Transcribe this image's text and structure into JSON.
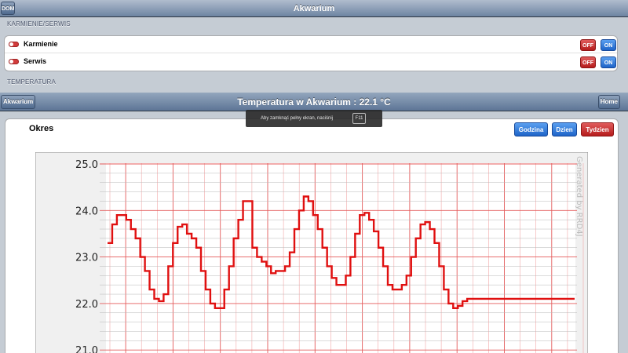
{
  "top_bar": {
    "back_label": "DOM",
    "title": "Akwarium"
  },
  "feeding": {
    "section_title": "KARMIENIE/SERWIS",
    "rows": [
      {
        "label": "Karmienie",
        "off": "OFF",
        "on": "ON"
      },
      {
        "label": "Serwis",
        "off": "OFF",
        "on": "ON"
      }
    ]
  },
  "temperature_section": {
    "title": "TEMPERATURA"
  },
  "chart_bar": {
    "left_label": "Akwarium",
    "title": "Temperatura w Akwarium : 22.1 °C",
    "right_label": "Home"
  },
  "toast": {
    "text": "Aby zamknąć pełny ekran, naciśnij",
    "key": "F11"
  },
  "content": {
    "okres_label": "Okres",
    "buttons": {
      "godzina": "Godzina",
      "dzien": "Dzien",
      "tydzien": "Tydzien"
    }
  },
  "colors": {
    "line": "#e01010",
    "grid": "#f2a8a8",
    "accent_blue": "#1e64c8",
    "accent_red": "#b51c1c"
  },
  "chart_data": {
    "type": "line",
    "watermark": "Generated by RRD4J",
    "ylim": [
      21.0,
      25.0
    ],
    "yticks": [
      "25.0",
      "24.0",
      "23.0",
      "22.0",
      "21.0"
    ],
    "grid": true,
    "x_index": [
      0,
      1,
      2,
      3,
      4,
      5,
      6,
      7,
      8,
      9,
      10,
      11,
      12,
      13,
      14,
      15,
      16,
      17,
      18,
      19,
      20,
      21,
      22,
      23,
      24,
      25,
      26,
      27,
      28,
      29,
      30,
      31,
      32,
      33,
      34,
      35,
      36,
      37,
      38,
      39,
      40,
      41,
      42,
      43,
      44,
      45,
      46,
      47,
      48,
      49,
      50,
      51,
      52,
      53,
      54,
      55,
      56,
      57,
      58,
      59,
      60,
      61,
      62,
      63,
      64,
      65,
      66,
      67,
      68,
      69,
      70,
      71,
      72,
      73,
      74,
      75,
      76,
      77,
      78,
      79,
      80,
      81,
      82,
      83,
      84,
      85,
      86,
      87,
      88,
      89,
      90,
      91,
      92,
      93,
      94,
      95,
      96,
      97,
      98,
      99,
      100
    ],
    "series": [
      {
        "values": [
          23.3,
          23.7,
          23.9,
          23.9,
          23.8,
          23.6,
          23.4,
          23.0,
          22.7,
          22.3,
          22.1,
          22.05,
          22.2,
          22.8,
          23.3,
          23.65,
          23.7,
          23.5,
          23.4,
          23.2,
          22.7,
          22.3,
          22.0,
          21.9,
          21.9,
          22.3,
          22.8,
          23.4,
          23.8,
          24.2,
          24.2,
          23.2,
          23.0,
          22.9,
          22.8,
          22.65,
          22.7,
          22.7,
          22.8,
          23.1,
          23.6,
          24.0,
          24.3,
          24.2,
          23.9,
          23.6,
          23.2,
          22.8,
          22.55,
          22.4,
          22.4,
          22.6,
          23.0,
          23.5,
          23.9,
          23.95,
          23.8,
          23.55,
          23.2,
          22.8,
          22.4,
          22.3,
          22.3,
          22.4,
          22.6,
          23.0,
          23.4,
          23.7,
          23.75,
          23.6,
          23.3,
          22.8,
          22.3,
          22.0,
          21.9,
          21.95,
          22.05,
          22.1,
          22.1,
          22.1,
          22.1,
          22.1,
          22.1,
          22.1,
          22.1,
          22.1,
          22.1,
          22.1,
          22.1,
          22.1,
          22.1,
          22.1,
          22.1,
          22.1,
          22.1,
          22.1,
          22.1,
          22.1,
          22.1,
          22.1,
          22.1
        ]
      }
    ]
  }
}
